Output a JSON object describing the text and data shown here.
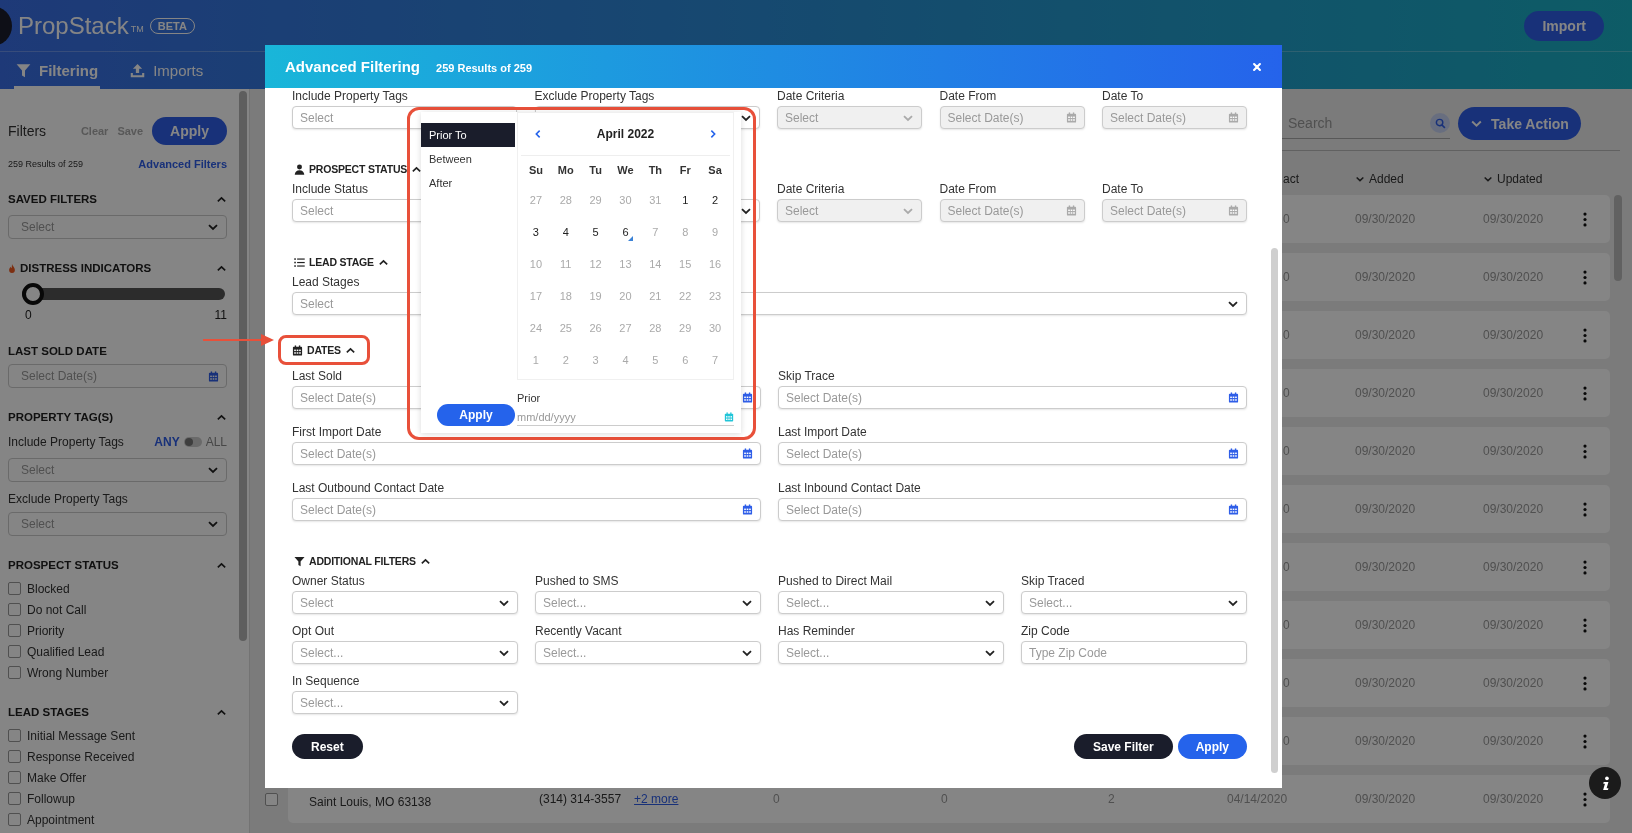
{
  "app_header": {
    "logo": "PropStack",
    "trademark": "TM",
    "badge": "BETA",
    "import_button": "Import"
  },
  "nav_tabs": [
    {
      "label": "Filtering",
      "selected": true,
      "kind": "filter"
    },
    {
      "label": "Imports",
      "selected": false,
      "kind": "upload"
    }
  ],
  "sidebar": {
    "title": "Filters",
    "clear": "Clear",
    "save": "Save",
    "apply": "Apply",
    "results": "259 Results of 259",
    "advanced_link": "Advanced Filters",
    "items": [
      {
        "kind": "heading",
        "text": "SAVED FILTERS",
        "expanded": true
      },
      {
        "kind": "select",
        "placeholder": "Select"
      },
      {
        "kind": "alertheading",
        "text": "DISTRESS INDICATORS",
        "expanded": true
      },
      {
        "kind": "slider",
        "level": 0,
        "min": "0",
        "max": "11"
      },
      {
        "kind": "title",
        "text": "LAST SOLD DATE"
      },
      {
        "kind": "date",
        "placeholder": "Select Date(s)"
      },
      {
        "kind": "heading",
        "text": "PROPERTY TAG(S)",
        "expanded": true
      },
      {
        "kind": "switch",
        "label": "Include Property Tags",
        "left": "ANY",
        "right": "ALL",
        "on": false
      },
      {
        "kind": "select",
        "placeholder": "Select"
      },
      {
        "kind": "label",
        "text": "Exclude Property Tags"
      },
      {
        "kind": "select",
        "placeholder": "Select"
      },
      {
        "kind": "heading",
        "text": "PROSPECT STATUS",
        "expanded": true
      },
      {
        "kind": "checkbox",
        "label": "Blocked",
        "checked": false
      },
      {
        "kind": "checkbox",
        "label": "Do not Call",
        "checked": false
      },
      {
        "kind": "checkbox",
        "label": "Priority",
        "checked": false
      },
      {
        "kind": "checkbox",
        "label": "Qualified Lead",
        "checked": false
      },
      {
        "kind": "checkbox",
        "label": "Wrong Number",
        "checked": false
      },
      {
        "kind": "heading",
        "text": "LEAD STAGES",
        "expanded": true
      },
      {
        "kind": "checkbox",
        "label": "Initial Message Sent",
        "checked": false
      },
      {
        "kind": "checkbox",
        "label": "Response Received",
        "checked": false
      },
      {
        "kind": "checkbox",
        "label": "Make Offer",
        "checked": false
      },
      {
        "kind": "checkbox",
        "label": "Followup",
        "checked": false
      },
      {
        "kind": "checkbox",
        "label": "Appointment",
        "checked": false
      }
    ]
  },
  "main": {
    "search": {
      "placeholder": "Search"
    },
    "take_action": "Take Action",
    "columns": [
      {
        "label": "act",
        "kind": "plain"
      },
      {
        "label": "Added",
        "kind": "sort"
      },
      {
        "label": "Updated",
        "kind": "sort"
      }
    ],
    "rows": [
      {
        "column_7": "0",
        "added": "09/30/2020",
        "updated": "09/30/2020"
      },
      {
        "column_7": "0",
        "added": "09/30/2020",
        "updated": "09/30/2020"
      },
      {
        "column_7": "0",
        "added": "09/30/2020",
        "updated": "09/30/2020"
      },
      {
        "column_7": "0",
        "added": "09/30/2020",
        "updated": "09/30/2020"
      },
      {
        "column_7": "0",
        "added": "09/30/2020",
        "updated": "09/30/2020"
      },
      {
        "column_7": "0",
        "added": "09/30/2020",
        "updated": "09/30/2020"
      },
      {
        "column_7": "0",
        "added": "09/30/2020",
        "updated": "09/30/2020"
      },
      {
        "column_7": "0",
        "added": "09/30/2020",
        "updated": "09/30/2020"
      },
      {
        "column_7": "0",
        "added": "09/30/2020",
        "updated": "09/30/2020"
      },
      {
        "column_7": "0",
        "added": "09/30/2020",
        "updated": "09/30/2020"
      },
      {
        "checked": false,
        "address": "Saint Louis, MO 63138",
        "phone": "(314) 314-3557",
        "more": "+2 more",
        "column_4": "0",
        "column_5": "0",
        "column_6": "2",
        "column_7": "04/14/2020",
        "added": "09/30/2020",
        "updated": "09/30/2020"
      }
    ]
  },
  "modal": {
    "title": "Advanced Filtering",
    "subtitle": "259 Results of 259",
    "blocks": [
      {
        "rows": [
          {
            "kind": "split",
            "fields": [
              {
                "label": "Include Property Tags",
                "kind": "combo",
                "placeholder": "Select",
                "disabled": false
              },
              {
                "label": "Exclude Property Tags",
                "kind": "select",
                "disabled": false
              },
              {
                "label": "Date Criteria",
                "kind": "select",
                "placeholder": "Select",
                "disabled": true
              },
              {
                "label": "Date From",
                "kind": "date",
                "placeholder": "Select Date(s)",
                "disabled": true
              },
              {
                "label": "Date To",
                "kind": "date",
                "placeholder": "Select Date(s)",
                "disabled": true
              }
            ]
          }
        ]
      },
      {
        "heading": {
          "text": "PROSPECT STATUS",
          "kind": "person",
          "expanded": true,
          "highlighted": false
        },
        "rows": [
          {
            "kind": "split",
            "fields": [
              {
                "label": "Include Status",
                "kind": "select",
                "placeholder": "Select",
                "disabled": false
              },
              {
                "label": "Date Criteria",
                "kind": "select",
                "placeholder": "Select",
                "disabled": true
              },
              {
                "label": "Date From",
                "kind": "date",
                "placeholder": "Select Date(s)",
                "disabled": true
              },
              {
                "label": "Date To",
                "kind": "date",
                "placeholder": "Select Date(s)",
                "disabled": true
              }
            ]
          }
        ]
      },
      {
        "heading": {
          "text": "LEAD STAGE",
          "kind": "list",
          "expanded": true,
          "highlighted": false
        },
        "rows": [
          {
            "kind": "single",
            "fields": [
              {
                "label": "Lead Stages",
                "kind": "select",
                "placeholder": "Select",
                "disabled": false
              }
            ]
          }
        ]
      },
      {
        "heading": {
          "text": "DATES",
          "kind": "calendar",
          "expanded": true,
          "highlighted": true
        },
        "rows": [
          {
            "kind": "double",
            "fields": [
              {
                "label": "Last Sold",
                "kind": "date",
                "placeholder": "Select Date(s)",
                "disabled": false
              },
              {
                "label": "Skip Trace",
                "kind": "date",
                "placeholder": "Select Date(s)",
                "disabled": false
              }
            ]
          },
          {
            "kind": "double",
            "fields": [
              {
                "label": "First Import Date",
                "kind": "date",
                "placeholder": "Select Date(s)",
                "disabled": false
              },
              {
                "label": "Last Import Date",
                "kind": "date",
                "placeholder": "Select Date(s)",
                "disabled": false
              }
            ]
          },
          {
            "kind": "double",
            "fields": [
              {
                "label": "Last Outbound Contact Date",
                "kind": "date",
                "placeholder": "Select Date(s)",
                "disabled": false
              },
              {
                "label": "Last Inbound Contact Date",
                "kind": "date",
                "placeholder": "Select Date(s)",
                "disabled": false
              }
            ]
          }
        ]
      },
      {
        "heading": {
          "text": "ADDITIONAL FILTERS",
          "kind": "filter",
          "expanded": true,
          "highlighted": false
        },
        "rows": [
          {
            "kind": "quad",
            "fields": [
              {
                "label": "Owner Status",
                "kind": "select",
                "placeholder": "Select",
                "disabled": false
              },
              {
                "label": "Pushed to SMS",
                "kind": "select",
                "placeholder": "Select...",
                "disabled": false
              },
              {
                "label": "Pushed to Direct Mail",
                "kind": "select",
                "placeholder": "Select...",
                "disabled": false
              },
              {
                "label": "Skip Traced",
                "kind": "select",
                "placeholder": "Select...",
                "disabled": false
              }
            ]
          },
          {
            "kind": "quad",
            "fields": [
              {
                "label": "Opt Out",
                "kind": "select",
                "placeholder": "Select...",
                "disabled": false
              },
              {
                "label": "Recently Vacant",
                "kind": "select",
                "placeholder": "Select...",
                "disabled": false
              },
              {
                "label": "Has Reminder",
                "kind": "select",
                "placeholder": "Select...",
                "disabled": false
              },
              {
                "label": "Zip Code",
                "kind": "text",
                "placeholder": "Type Zip Code",
                "disabled": false
              }
            ]
          },
          {
            "kind": "quad",
            "fields": [
              {
                "label": "In Sequence",
                "kind": "select",
                "placeholder": "Select...",
                "disabled": false
              }
            ]
          }
        ]
      }
    ],
    "buttons": {
      "reset": "Reset",
      "save": "Save Filter",
      "apply": "Apply"
    }
  },
  "datepicker": {
    "highlighted": true,
    "options": [
      {
        "label": "Prior To",
        "selected": true
      },
      {
        "label": "Between",
        "selected": false
      },
      {
        "label": "After",
        "selected": false
      }
    ],
    "month": "April 2022",
    "weekdays": [
      "Su",
      "Mo",
      "Tu",
      "We",
      "Th",
      "Fr",
      "Sa"
    ],
    "days": [
      {
        "text": "27",
        "disabled": true,
        "today": false
      },
      {
        "text": "28",
        "disabled": true,
        "today": false
      },
      {
        "text": "29",
        "disabled": true,
        "today": false
      },
      {
        "text": "30",
        "disabled": true,
        "today": false
      },
      {
        "text": "31",
        "disabled": true,
        "today": false
      },
      {
        "text": "1",
        "disabled": false,
        "today": false
      },
      {
        "text": "2",
        "disabled": false,
        "today": false
      },
      {
        "text": "3",
        "disabled": false,
        "today": false
      },
      {
        "text": "4",
        "disabled": false,
        "today": false
      },
      {
        "text": "5",
        "disabled": false,
        "today": false
      },
      {
        "text": "6",
        "disabled": false,
        "today": true
      },
      {
        "text": "7",
        "disabled": true,
        "today": false
      },
      {
        "text": "8",
        "disabled": true,
        "today": false
      },
      {
        "text": "9",
        "disabled": true,
        "today": false
      },
      {
        "text": "10",
        "disabled": true,
        "today": false
      },
      {
        "text": "11",
        "disabled": true,
        "today": false
      },
      {
        "text": "12",
        "disabled": true,
        "today": false
      },
      {
        "text": "13",
        "disabled": true,
        "today": false
      },
      {
        "text": "14",
        "disabled": true,
        "today": false
      },
      {
        "text": "15",
        "disabled": true,
        "today": false
      },
      {
        "text": "16",
        "disabled": true,
        "today": false
      },
      {
        "text": "17",
        "disabled": true,
        "today": false
      },
      {
        "text": "18",
        "disabled": true,
        "today": false
      },
      {
        "text": "19",
        "disabled": true,
        "today": false
      },
      {
        "text": "20",
        "disabled": true,
        "today": false
      },
      {
        "text": "21",
        "disabled": true,
        "today": false
      },
      {
        "text": "22",
        "disabled": true,
        "today": false
      },
      {
        "text": "23",
        "disabled": true,
        "today": false
      },
      {
        "text": "24",
        "disabled": true,
        "today": false
      },
      {
        "text": "25",
        "disabled": true,
        "today": false
      },
      {
        "text": "26",
        "disabled": true,
        "today": false
      },
      {
        "text": "27",
        "disabled": true,
        "today": false
      },
      {
        "text": "28",
        "disabled": true,
        "today": false
      },
      {
        "text": "29",
        "disabled": true,
        "today": false
      },
      {
        "text": "30",
        "disabled": true,
        "today": false
      },
      {
        "text": "1",
        "disabled": true,
        "today": false
      },
      {
        "text": "2",
        "disabled": true,
        "today": false
      },
      {
        "text": "3",
        "disabled": true,
        "today": false
      },
      {
        "text": "4",
        "disabled": true,
        "today": false
      },
      {
        "text": "5",
        "disabled": true,
        "today": false
      },
      {
        "text": "6",
        "disabled": true,
        "today": false
      },
      {
        "text": "7",
        "disabled": true,
        "today": false
      }
    ],
    "apply": "Apply",
    "input_label": "Prior",
    "input_placeholder": "mm/dd/yyyy"
  }
}
